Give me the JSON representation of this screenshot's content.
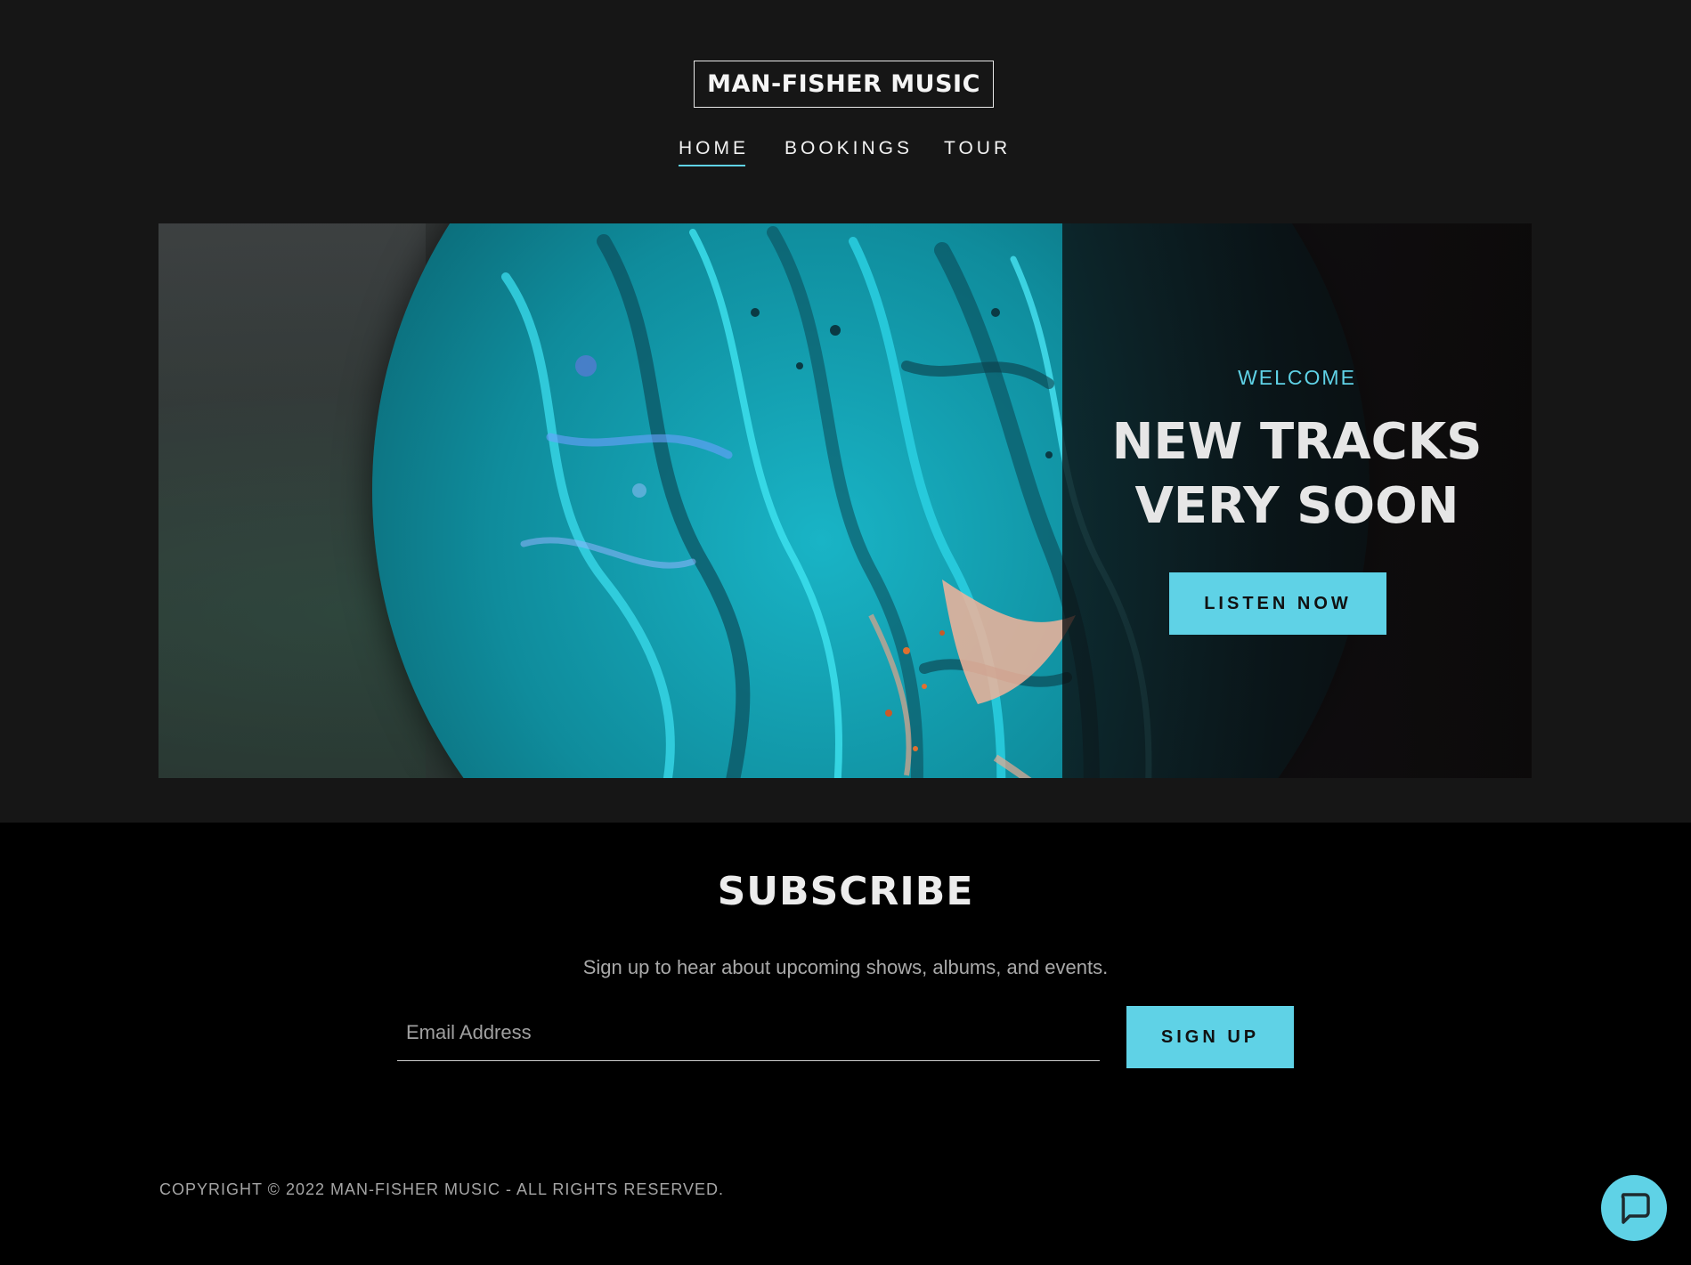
{
  "brand": {
    "logo_text": "MAN-FISHER MUSIC"
  },
  "nav": {
    "items": [
      {
        "label": "HOME",
        "active": true
      },
      {
        "label": "BOOKINGS",
        "active": false
      },
      {
        "label": "TOUR",
        "active": false
      }
    ]
  },
  "hero": {
    "eyebrow": "WELCOME",
    "title_line1": "NEW TRACKS",
    "title_line2": "VERY SOON",
    "cta_label": "LISTEN NOW"
  },
  "subscribe": {
    "title": "SUBSCRIBE",
    "description": "Sign up to hear about upcoming shows, albums, and events.",
    "email_placeholder": "Email Address",
    "button_label": "SIGN UP"
  },
  "footer": {
    "copyright": "COPYRIGHT © 2022 MAN-FISHER MUSIC - ALL RIGHTS RESERVED."
  },
  "chat": {
    "icon": "chat-bubble-icon"
  },
  "colors": {
    "accent": "#5fd2e6",
    "header_bg": "#161616",
    "footer_bg": "#000000"
  }
}
